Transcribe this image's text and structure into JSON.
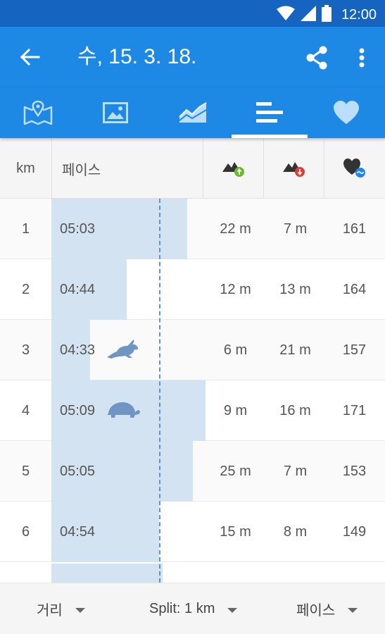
{
  "status_bar": {
    "time": "12:00",
    "icons": [
      "wifi-icon",
      "signal-icon",
      "battery-icon"
    ]
  },
  "app_bar": {
    "title": "수, 15. 3. 18.",
    "icons": [
      "back-arrow-icon",
      "share-icon",
      "more-vert-icon"
    ]
  },
  "tabs": [
    {
      "name": "map-tab",
      "icon": "map-icon"
    },
    {
      "name": "photos-tab",
      "icon": "image-icon"
    },
    {
      "name": "graph-tab",
      "icon": "chart-icon"
    },
    {
      "name": "splits-tab",
      "icon": "bars-icon",
      "active": true
    },
    {
      "name": "heart-rate-tab",
      "icon": "heart-icon"
    }
  ],
  "table": {
    "headers": {
      "km": "km",
      "pace": "페이스",
      "ascent_icon": "elevation-gain-icon",
      "descent_icon": "elevation-loss-icon",
      "heart_icon": "avg-heart-rate-icon"
    },
    "pace_bar_fractions": [
      0.88,
      0.49,
      0.25,
      1.0,
      0.92,
      0.7
    ],
    "avg_pace_fraction": 0.7,
    "rows": [
      {
        "km": "1",
        "pace": "05:03",
        "ascent": "22 m",
        "descent": "7 m",
        "hr": "161"
      },
      {
        "km": "2",
        "pace": "04:44",
        "ascent": "12 m",
        "descent": "13 m",
        "hr": "164"
      },
      {
        "km": "3",
        "pace": "04:33",
        "ascent": "6 m",
        "descent": "21 m",
        "hr": "157",
        "badge": "rabbit-icon"
      },
      {
        "km": "4",
        "pace": "05:09",
        "ascent": "9 m",
        "descent": "16 m",
        "hr": "171",
        "badge": "turtle-icon"
      },
      {
        "km": "5",
        "pace": "05:05",
        "ascent": "25 m",
        "descent": "7 m",
        "hr": "153"
      },
      {
        "km": "6",
        "pace": "04:54",
        "ascent": "15 m",
        "descent": "8 m",
        "hr": "149"
      }
    ]
  },
  "bottom_bar": {
    "left_dropdown": "거리",
    "center_dropdown": "Split: 1 km",
    "right_dropdown": "페이스"
  },
  "colors": {
    "status_bar": "#1565c0",
    "app_bar": "#1e88e5",
    "pace_bar": "#d4e3f2",
    "avg_line": "#5c93d4",
    "ascent_arrow": "#4caf50",
    "descent_arrow": "#e53935",
    "heart_badge": "#1e88e5"
  }
}
